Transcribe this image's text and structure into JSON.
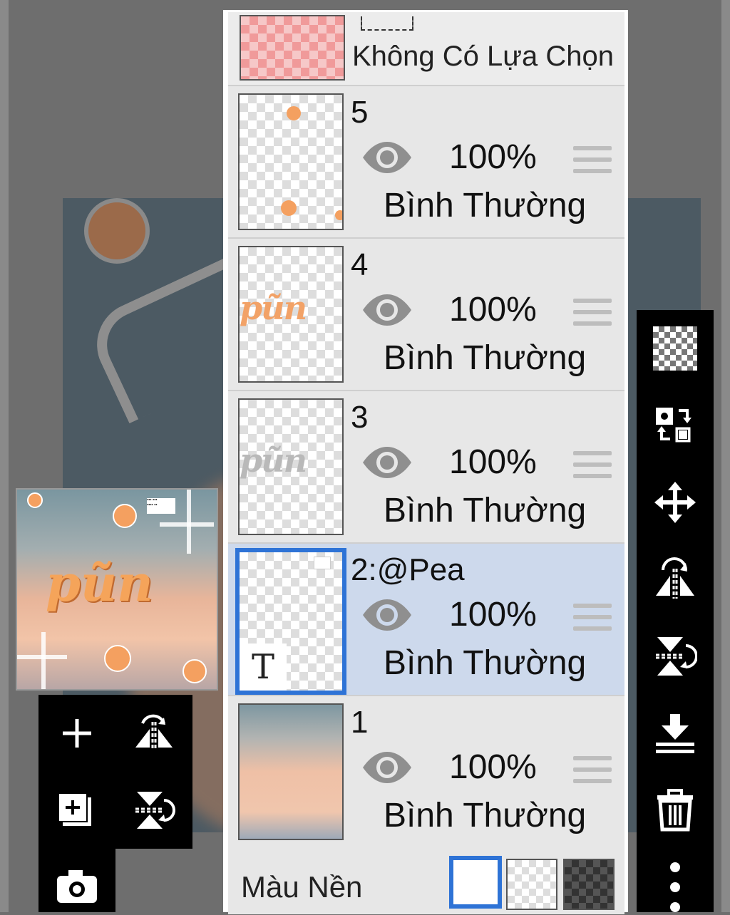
{
  "selection_row": {
    "label": "Không Có Lựa Chọn"
  },
  "layers": [
    {
      "name": "5",
      "opacity": "100%",
      "blend_mode": "Bình Thường",
      "visible": true,
      "selected": false
    },
    {
      "name": "4",
      "opacity": "100%",
      "blend_mode": "Bình Thường",
      "visible": true,
      "selected": false
    },
    {
      "name": "3",
      "opacity": "100%",
      "blend_mode": "Bình Thường",
      "visible": true,
      "selected": false
    },
    {
      "name": "2:@Pea",
      "opacity": "100%",
      "blend_mode": "Bình Thường",
      "visible": true,
      "selected": true,
      "type_badge": "T"
    },
    {
      "name": "1",
      "opacity": "100%",
      "blend_mode": "Bình Thường",
      "visible": true,
      "selected": false
    }
  ],
  "background": {
    "label": "Màu Nền",
    "options": [
      "white",
      "transparent",
      "dark-checker"
    ],
    "selected": "white"
  },
  "preview": {
    "word": "pũn"
  },
  "colors": {
    "accent": "#2e73d6",
    "selected_row": "#cdd9ec",
    "panel": "#e7e7e7",
    "toolbar": "#000000"
  },
  "left_tools": [
    "add-layer-icon",
    "flip-horizontal-icon",
    "add-copy-icon",
    "flip-vertical-icon",
    "camera-icon"
  ],
  "right_tools": [
    "transparency-icon",
    "swap-layers-icon",
    "move-icon",
    "flip-horizontal-icon",
    "flip-vertical-icon",
    "merge-down-icon",
    "trash-icon",
    "more-vertical-icon"
  ]
}
